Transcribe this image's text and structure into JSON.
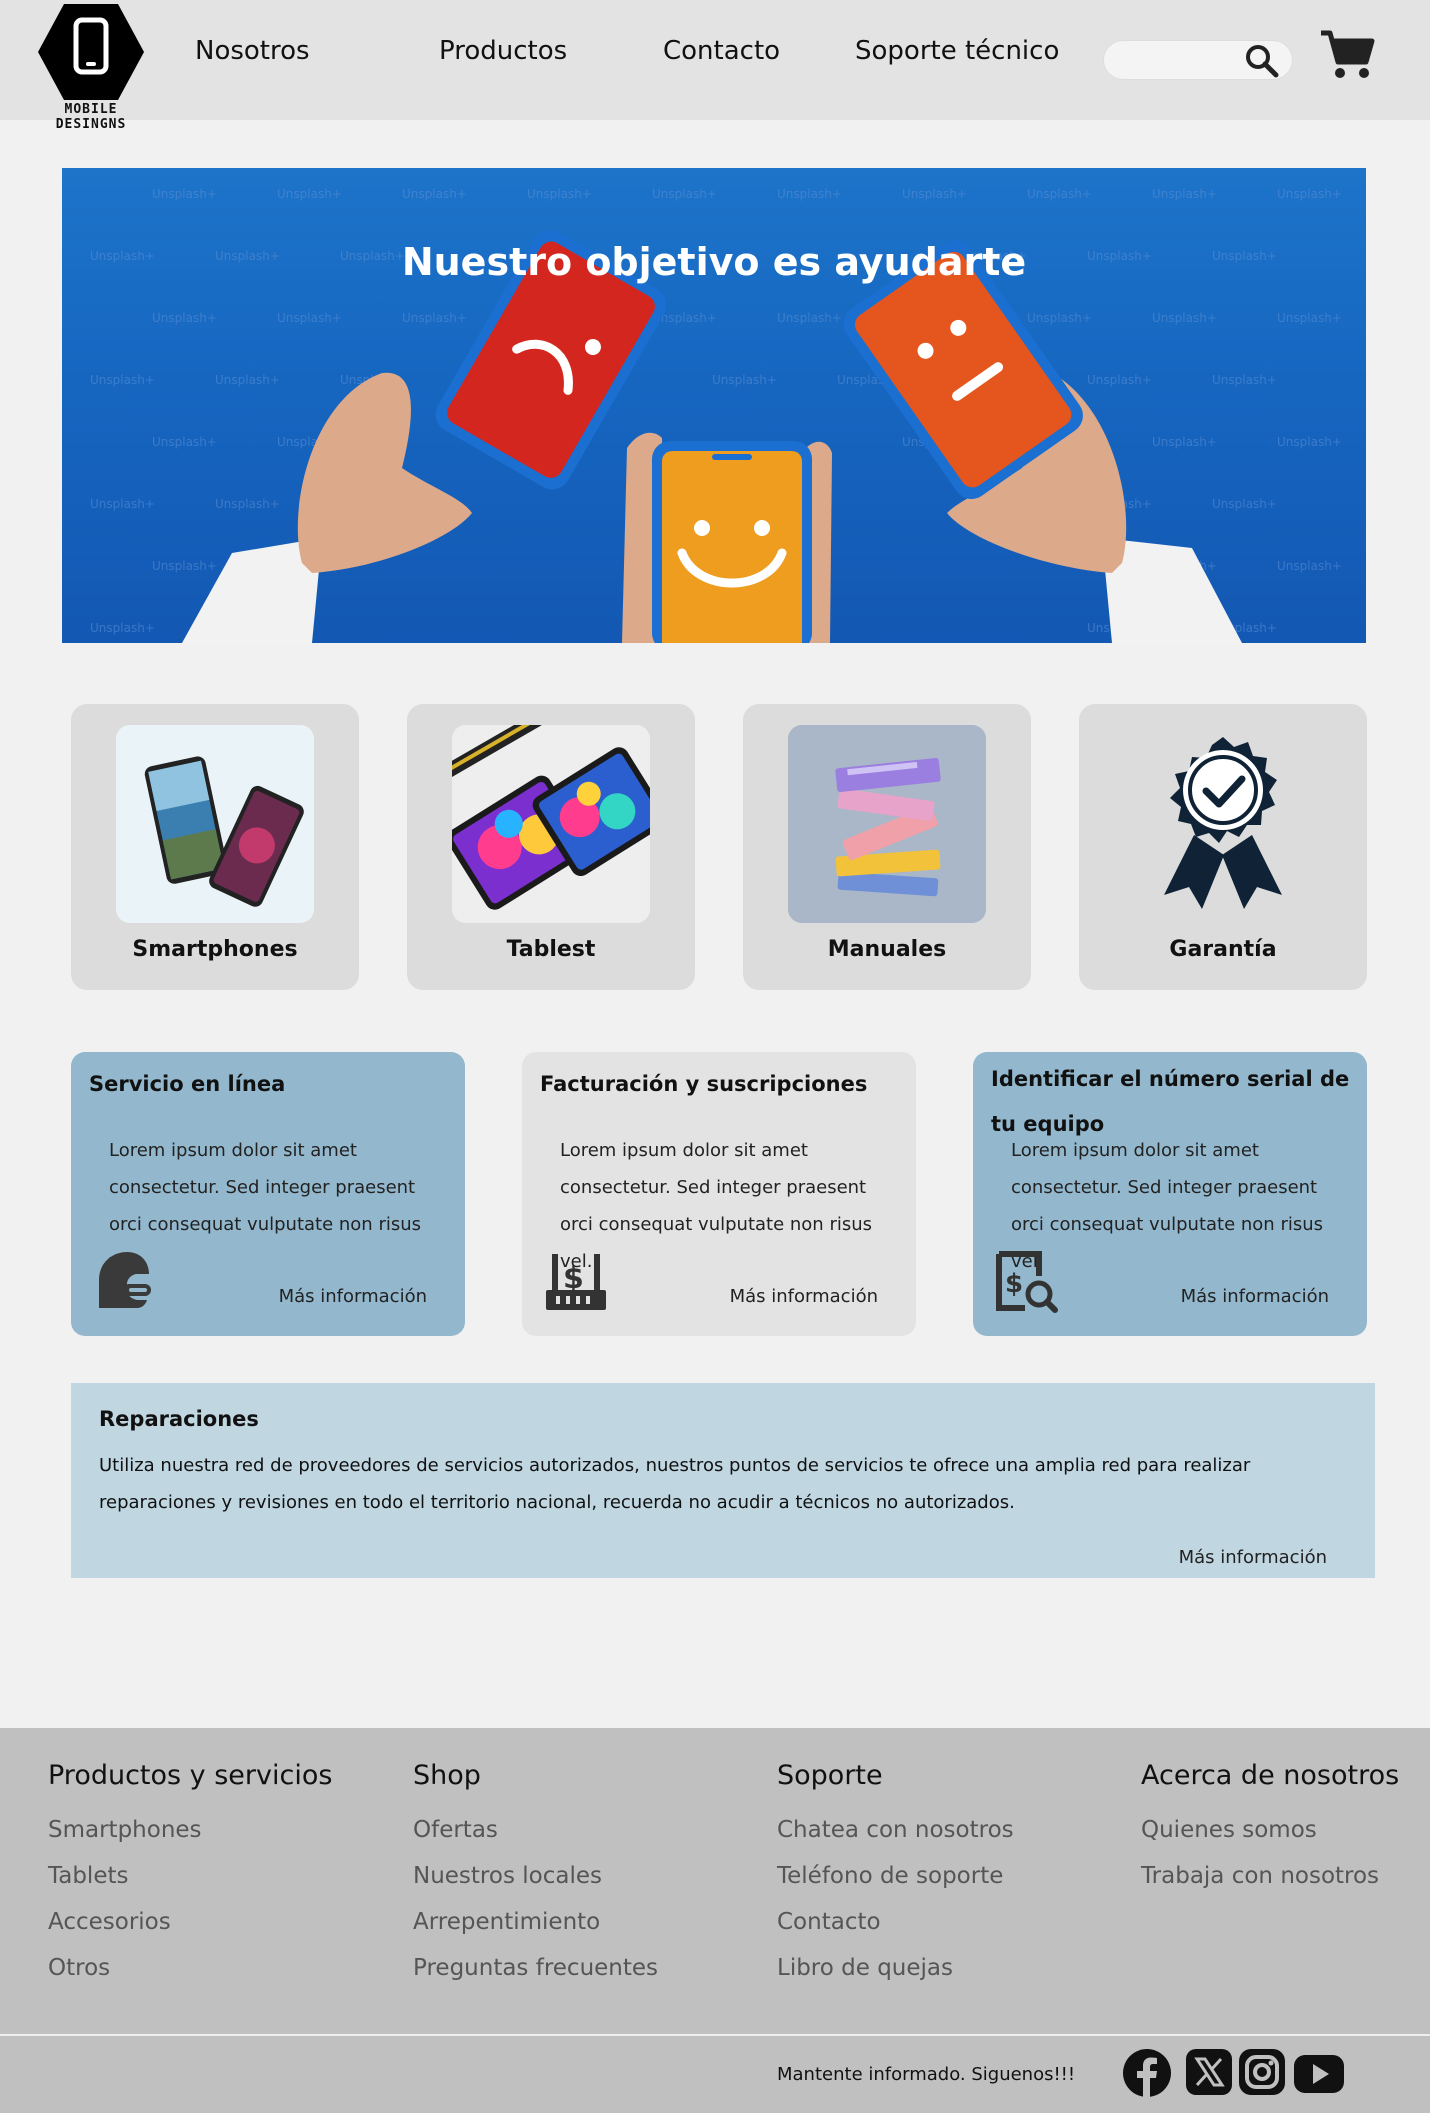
{
  "header": {
    "logo_text": "MOBILE DESINGNS",
    "nav": [
      "Nosotros",
      "Productos",
      "Contacto",
      "Soporte técnico"
    ],
    "search_placeholder": "",
    "search_icon": "search-icon",
    "cart_icon": "cart-icon"
  },
  "hero": {
    "title": "Nuestro objetivo es ayudarte",
    "watermark": "Unsplash+"
  },
  "categories": [
    {
      "label": "Smartphones",
      "icon": "smartphones-image"
    },
    {
      "label": "Tablest",
      "icon": "tablets-image"
    },
    {
      "label": "Manuales",
      "icon": "books-image"
    },
    {
      "label": "Garantía",
      "icon": "award-badge-icon"
    }
  ],
  "info_cards": [
    {
      "title": "Servicio en línea",
      "body": "Lorem ipsum dolor sit amet consectetur. Sed integer praesent orci consequat vulputate non risus vel.",
      "link": "Más información",
      "icon": "headset-icon"
    },
    {
      "title": "Facturación y suscripciones",
      "body": "Lorem ipsum dolor sit amet consectetur. Sed integer praesent orci consequat vulputate non risus vel.",
      "link": "Más información",
      "icon": "billing-icon"
    },
    {
      "title": "Identificar el número serial de tu equipo",
      "body": "Lorem ipsum dolor sit amet consectetur. Sed integer praesent orci consequat vulputate non risus vel.",
      "link": "Más información",
      "icon": "serial-search-icon"
    }
  ],
  "repairs": {
    "title": "Reparaciones",
    "body": "Utiliza nuestra red de proveedores de servicios autorizados, nuestros puntos de servicios te ofrece una amplia red para realizar reparaciones y revisiones en todo el territorio nacional, recuerda no acudir a técnicos no autorizados.",
    "link": "Más información"
  },
  "footer": {
    "columns": [
      {
        "heading": "Productos y servicios",
        "links": [
          "Smartphones",
          "Tablets",
          "Accesorios",
          "Otros"
        ]
      },
      {
        "heading": "Shop",
        "links": [
          "Ofertas",
          "Nuestros locales",
          "Arrepentimiento",
          "Preguntas frecuentes"
        ]
      },
      {
        "heading": "Soporte",
        "links": [
          "Chatea con nosotros",
          "Teléfono de soporte",
          "Contacto",
          "Libro de quejas"
        ]
      },
      {
        "heading": "Acerca de nosotros",
        "links": [
          "Quienes somos",
          "Trabaja con nosotros"
        ]
      }
    ],
    "follow_text": "Mantente informado. Siguenos!!!",
    "social": [
      "facebook-icon",
      "x-icon",
      "instagram-icon",
      "youtube-icon"
    ]
  },
  "colors": {
    "header_bg": "#e3e3e3",
    "hero_blue": "#1666c0",
    "card_blue": "#93b8cd",
    "repairs_bg": "#c0d6e1",
    "footer_bg": "#c0c0c0"
  }
}
